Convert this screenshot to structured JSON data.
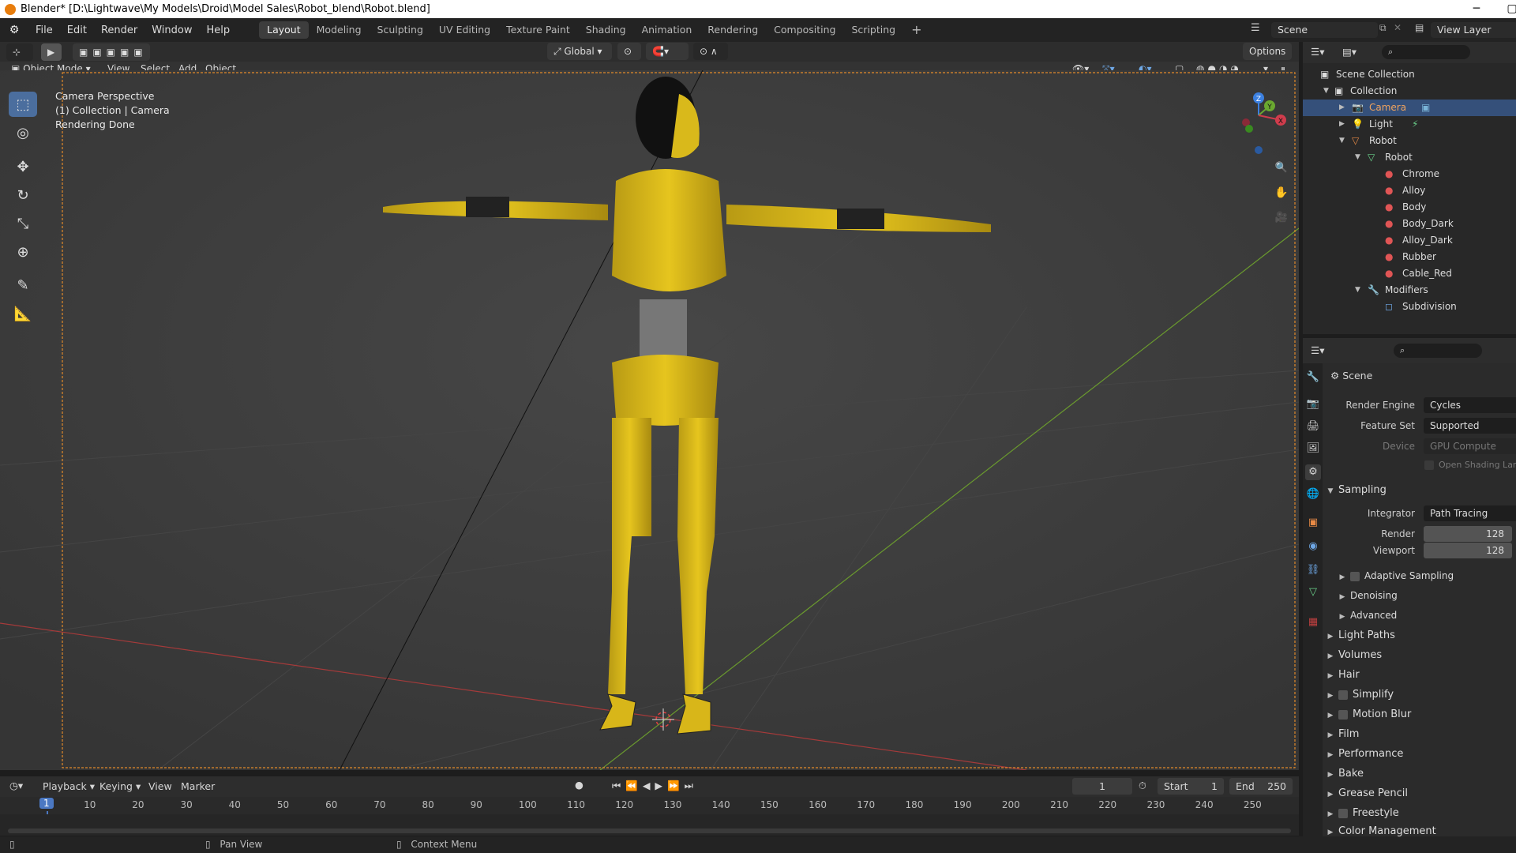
{
  "window": {
    "title": "Blender* [D:\\Lightwave\\My Models\\Droid\\Model Sales\\Robot_blend\\Robot.blend]"
  },
  "menus": [
    "File",
    "Edit",
    "Render",
    "Window",
    "Help"
  ],
  "workspaces": [
    "Layout",
    "Modeling",
    "Sculpting",
    "UV Editing",
    "Texture Paint",
    "Shading",
    "Animation",
    "Rendering",
    "Compositing",
    "Scripting"
  ],
  "active_workspace": "Layout",
  "scene_field": "Scene",
  "view_layer_field": "View Layer",
  "viewport_header": {
    "mode": "Object Mode",
    "menus": [
      "View",
      "Select",
      "Add",
      "Object"
    ],
    "orientation": "Global",
    "options": "Options"
  },
  "viewport_overlay": {
    "line1": "Camera Perspective",
    "line2": "(1) Collection | Camera",
    "line3": "Rendering Done"
  },
  "gizmo_axes": {
    "z": "Z",
    "y": "Y",
    "x": "X"
  },
  "outliner": {
    "rows": [
      {
        "label": "Scene Collection"
      },
      {
        "label": "Collection"
      },
      {
        "label": "Camera"
      },
      {
        "label": "Light"
      },
      {
        "label": "Robot"
      },
      {
        "label": "Robot"
      },
      {
        "label": "Chrome"
      },
      {
        "label": "Alloy"
      },
      {
        "label": "Body"
      },
      {
        "label": "Body_Dark"
      },
      {
        "label": "Alloy_Dark"
      },
      {
        "label": "Rubber"
      },
      {
        "label": "Cable_Red"
      },
      {
        "label": "Modifiers"
      },
      {
        "label": "Subdivision"
      }
    ]
  },
  "properties": {
    "context": "Scene",
    "render_engine_label": "Render Engine",
    "render_engine": "Cycles",
    "feature_set_label": "Feature Set",
    "feature_set": "Supported",
    "device_label": "Device",
    "device": "GPU Compute",
    "osl_label": "Open Shading Lang",
    "sampling": "Sampling",
    "integrator_label": "Integrator",
    "integrator": "Path Tracing",
    "render_label": "Render",
    "render_samples": "128",
    "viewport_label": "Viewport",
    "viewport_samples": "128",
    "subpanels": [
      "Adaptive Sampling",
      "Denoising",
      "Advanced"
    ],
    "panels": [
      "Light Paths",
      "Volumes",
      "Hair",
      "Simplify",
      "Motion Blur",
      "Film",
      "Performance",
      "Bake",
      "Grease Pencil",
      "Freestyle",
      "Color Management"
    ]
  },
  "timeline": {
    "menus": [
      "Playback",
      "Keying",
      "View",
      "Marker"
    ],
    "current_frame": "1",
    "start_label": "Start",
    "start": "1",
    "end_label": "End",
    "end": "250",
    "ticks": [
      "1",
      "10",
      "20",
      "30",
      "40",
      "50",
      "60",
      "70",
      "80",
      "90",
      "100",
      "110",
      "120",
      "130",
      "140",
      "150",
      "160",
      "170",
      "180",
      "190",
      "200",
      "210",
      "220",
      "230",
      "240",
      "250"
    ]
  },
  "statusbar": {
    "pan": "Pan View",
    "context": "Context Menu"
  }
}
